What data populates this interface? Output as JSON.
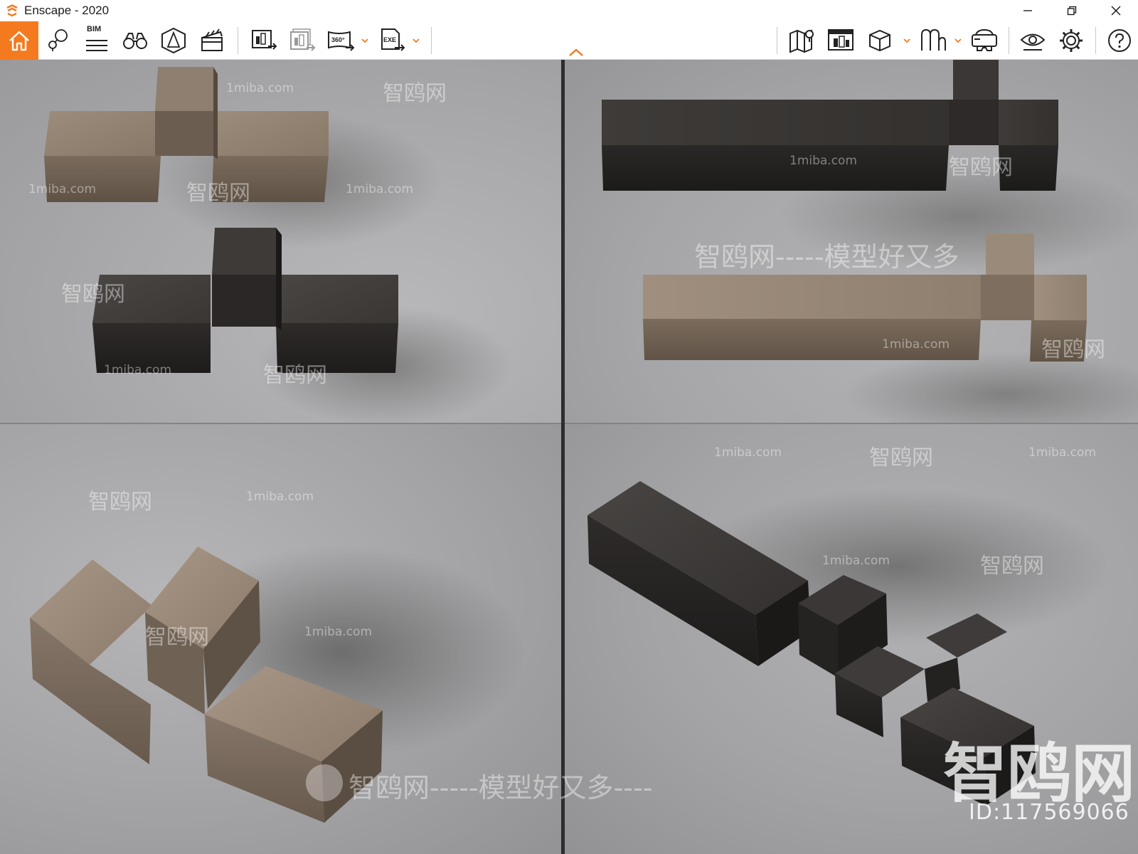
{
  "window": {
    "title": "Enscape - 2020",
    "controls": [
      "minimize",
      "restore",
      "close"
    ]
  },
  "toolbar": {
    "bim_label": "BIM",
    "pano_label": "360°",
    "exe_label": "EXE",
    "accent": "#f47a20",
    "left_icons": [
      "home-icon",
      "location-pin-icon",
      "bim-icon",
      "binoculars-icon",
      "perspective-icon",
      "clapperboard-icon",
      "screenshot-export-icon",
      "batch-render-icon",
      "panorama-360-icon",
      "exe-export-icon"
    ],
    "right_icons": [
      "map-icon",
      "asset-library-icon",
      "view-cube-icon",
      "material-icon",
      "vr-headset-icon",
      "visual-settings-icon",
      "settings-icon",
      "help-icon"
    ]
  },
  "viewport": {
    "watermarks": {
      "site": "1miba.com",
      "brand": "智鸥网",
      "slogan": "智鸥网-----模型好又多----",
      "slogan_full": "智鸥网-----模型好又多",
      "id": "ID:117569066",
      "dashes": "-------"
    }
  }
}
